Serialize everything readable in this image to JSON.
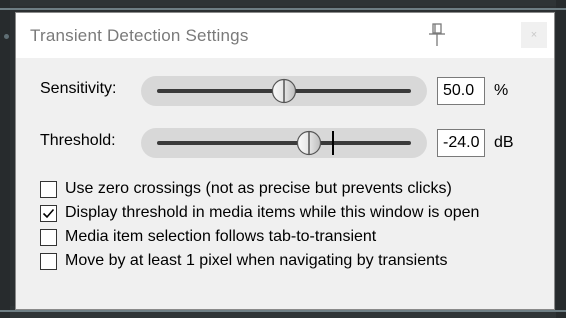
{
  "dialog": {
    "title": "Transient Detection Settings",
    "close_label": "×"
  },
  "sensitivity": {
    "label": "Sensitivity:",
    "value": "50.0",
    "unit": "%",
    "slider_fraction": 0.5
  },
  "threshold": {
    "label": "Threshold:",
    "value": "-24.0",
    "unit": "dB",
    "slider_fraction": 0.6,
    "marker_fraction": 0.69
  },
  "options": [
    {
      "label": "Use zero crossings (not as precise but prevents clicks)",
      "checked": false
    },
    {
      "label": "Display threshold in media items while this window is open",
      "checked": true
    },
    {
      "label": "Media item selection follows tab-to-transient",
      "checked": false
    },
    {
      "label": "Move by at least 1 pixel when navigating by transients",
      "checked": false
    }
  ],
  "icons": {
    "pin": "pin-icon",
    "close": "close-icon",
    "thumb": "slider-thumb-icon",
    "check": "checkmark-icon"
  }
}
